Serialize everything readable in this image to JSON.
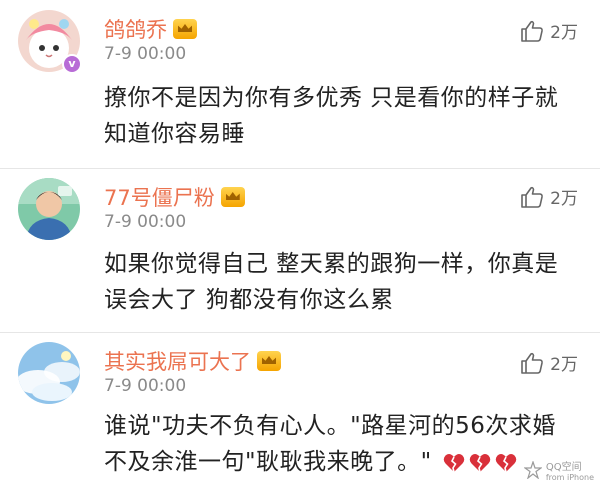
{
  "comments": [
    {
      "username": "鸽鸽乔",
      "time": "7-9 00:00",
      "likes": "2万",
      "text_lines": [
        "撩你不是因为你有多优秀 只是看你的样子就",
        "知道你容易睡"
      ],
      "verified_badge": "v"
    },
    {
      "username": "77号僵尸粉",
      "time": "7-9 00:00",
      "likes": "2万",
      "text_lines": [
        "如果你觉得自己 整天累的跟狗一样，你真是",
        "误会大了 狗都没有你这么累"
      ]
    },
    {
      "username": "其实我屌可大了",
      "time": "7-9 00:00",
      "likes": "2万",
      "text_lines": [
        "谁说\"功夫不负有心人。\"路星河的56次求婚",
        "不及余淮一句\"耿耿我来晚了。\""
      ]
    }
  ],
  "icons": {
    "like": "thumbs-up-icon",
    "vip": "crown-icon",
    "broken_heart": "broken-heart-icon"
  },
  "colors": {
    "username": "#eb7350",
    "time": "#8a8a8a",
    "text": "#222222",
    "divider": "#e6e6e6",
    "broken_heart": "#d9303a"
  },
  "watermark": {
    "title": "QQ空间",
    "subtitle": "from iPhone"
  }
}
